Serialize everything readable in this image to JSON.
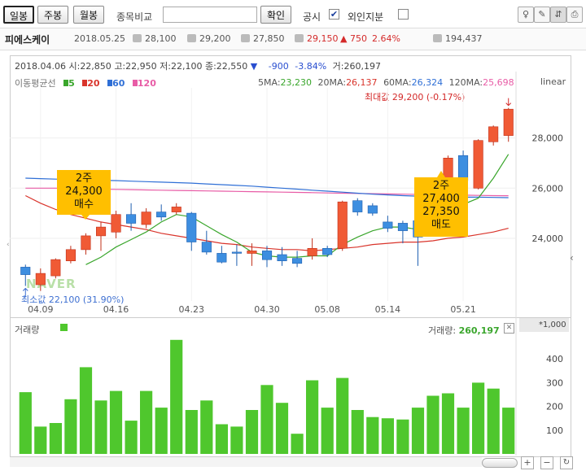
{
  "toolbar": {
    "period_tabs": [
      "일봉",
      "주봉",
      "월봉"
    ],
    "compare_label": "종목비교",
    "compare_placeholder": "",
    "confirm_label": "확인",
    "disclosure_label": "공시",
    "foreign_label": "외인지분"
  },
  "stock_info": {
    "name": "피에스케이",
    "date": "2018.05.25",
    "open": "28,100",
    "high": "29,200",
    "low": "27,850",
    "close": "29,150",
    "change": "▲ 750",
    "change_pct": "2.64%",
    "volume": "194,437"
  },
  "hover_info": {
    "date": "2018.04.06",
    "open_label": "시:",
    "open": "22,850",
    "high_label": "고:",
    "high": "22,950",
    "low_label": "저:",
    "low": "22,100",
    "close_label": "종:",
    "close": "22,550",
    "arrow": "▼",
    "change": "-900",
    "change_pct": "-3.84%",
    "volume_label": "거:",
    "volume": "260,197"
  },
  "legend": {
    "title": "이동평균선",
    "items": [
      {
        "label": "5",
        "color": "#3aa62c"
      },
      {
        "label": "20",
        "color": "#d9342b"
      },
      {
        "label": "60",
        "color": "#2f6fd6"
      },
      {
        "label": "120",
        "color": "#e85ca6"
      }
    ]
  },
  "ma_values": [
    {
      "label": "5MA:",
      "value": "23,230",
      "color": "#3aa62c"
    },
    {
      "label": "20MA:",
      "value": "26,137",
      "color": "#d9342b"
    },
    {
      "label": "60MA:",
      "value": "26,324",
      "color": "#2f6fd6"
    },
    {
      "label": "120MA:",
      "value": "25,698",
      "color": "#e85ca6"
    }
  ],
  "scale_label": "linear",
  "max_label": "최대값 29,200 (-0.17%)",
  "min_label": "최소값 22,100 (31.90%)",
  "watermark": "NAVER",
  "callouts": [
    {
      "lines": [
        "2주",
        "24,300",
        "매수"
      ]
    },
    {
      "lines": [
        "2주",
        "27,400",
        "27,350",
        "매도"
      ]
    }
  ],
  "volume_panel": {
    "title": "거래량",
    "value_label": "거래량:",
    "value": "260,197",
    "unit": "*1,000"
  },
  "colors": {
    "up": "#f05a35",
    "down": "#3d8ee0",
    "volume": "#4fc72d",
    "callout": "#ffbf00"
  },
  "chart_data": [
    {
      "type": "candlestick",
      "title": "",
      "x": [
        "04.06",
        "04.09",
        "04.10",
        "04.11",
        "04.12",
        "04.13",
        "04.16",
        "04.17",
        "04.18",
        "04.19",
        "04.20",
        "04.23",
        "04.24",
        "04.25",
        "04.26",
        "04.27",
        "04.30",
        "05.02",
        "05.03",
        "05.04",
        "05.08",
        "05.09",
        "05.10",
        "05.11",
        "05.14",
        "05.15",
        "05.16",
        "05.17",
        "05.18",
        "05.21",
        "05.23",
        "05.24",
        "05.25"
      ],
      "x_ticks": [
        "04.09",
        "04.16",
        "04.23",
        "04.30",
        "05.08",
        "05.14",
        "05.21"
      ],
      "y_ticks": [
        24000,
        26000,
        28000
      ],
      "ylim": [
        21500,
        30000
      ],
      "ohlc": [
        [
          22850,
          22950,
          22100,
          22550
        ],
        [
          22150,
          22800,
          21900,
          22600
        ],
        [
          22500,
          23200,
          22400,
          23150
        ],
        [
          23100,
          23700,
          23000,
          23550
        ],
        [
          23550,
          24200,
          23350,
          24100
        ],
        [
          24100,
          24650,
          23500,
          24450
        ],
        [
          24250,
          25100,
          24000,
          24950
        ],
        [
          24950,
          25400,
          24300,
          24600
        ],
        [
          24550,
          25200,
          24400,
          25050
        ],
        [
          25050,
          25350,
          24700,
          24850
        ],
        [
          25050,
          25400,
          24950,
          25250
        ],
        [
          25000,
          25050,
          23500,
          23850
        ],
        [
          23850,
          24300,
          23350,
          23450
        ],
        [
          23400,
          23700,
          23000,
          23050
        ],
        [
          23450,
          23750,
          22900,
          23400
        ],
        [
          23400,
          23800,
          22900,
          23500
        ],
        [
          23500,
          23700,
          22850,
          23150
        ],
        [
          23350,
          23650,
          22900,
          23100
        ],
        [
          23200,
          23500,
          22850,
          23000
        ],
        [
          23300,
          24000,
          23150,
          23600
        ],
        [
          23600,
          23700,
          23250,
          23350
        ],
        [
          23600,
          25500,
          23500,
          25450
        ],
        [
          25500,
          25600,
          24900,
          25050
        ],
        [
          25300,
          25400,
          24900,
          25000
        ],
        [
          24650,
          24900,
          24250,
          24400
        ],
        [
          24600,
          24700,
          23800,
          24300
        ],
        [
          24700,
          25000,
          22900,
          24050
        ],
        [
          25200,
          25600,
          24650,
          25300
        ],
        [
          25400,
          27300,
          25300,
          27200
        ],
        [
          27300,
          27500,
          26000,
          26300
        ],
        [
          26000,
          27950,
          25950,
          27900
        ],
        [
          27850,
          28500,
          27700,
          28450
        ],
        [
          28100,
          29200,
          27850,
          29150
        ]
      ],
      "ma5": [
        null,
        null,
        null,
        null,
        22950,
        23250,
        23650,
        23950,
        24250,
        24650,
        24950,
        24850,
        24500,
        24150,
        23850,
        23450,
        23300,
        23250,
        23250,
        23300,
        23300,
        23750,
        24050,
        24300,
        24450,
        24450,
        24350,
        24400,
        25050,
        25350,
        25600,
        26400,
        27350
      ],
      "ma20": [
        25700,
        25400,
        25150,
        24950,
        24800,
        24650,
        24550,
        24450,
        24350,
        24200,
        24100,
        24000,
        23900,
        23800,
        23750,
        23650,
        23600,
        23550,
        23550,
        23500,
        23550,
        23600,
        23650,
        23750,
        23800,
        23850,
        23850,
        23900,
        24000,
        24050,
        24150,
        24250,
        24400
      ],
      "ma60": [
        26400,
        26380,
        26360,
        26350,
        26330,
        26310,
        26300,
        26280,
        26260,
        26240,
        26220,
        26200,
        26170,
        26140,
        26110,
        26080,
        26040,
        26000,
        25960,
        25920,
        25880,
        25840,
        25800,
        25760,
        25730,
        25700,
        25680,
        25660,
        25650,
        25640,
        25640,
        25630,
        25620
      ],
      "ma120": [
        26000,
        26000,
        26000,
        25990,
        25980,
        25960,
        25950,
        25940,
        25930,
        25920,
        25910,
        25900,
        25890,
        25880,
        25870,
        25860,
        25850,
        25840,
        25830,
        25820,
        25810,
        25800,
        25790,
        25780,
        25770,
        25760,
        25750,
        25740,
        25730,
        25720,
        25710,
        25700,
        25698
      ]
    },
    {
      "type": "bar",
      "title": "거래량",
      "ylabel": "*1,000",
      "y_ticks": [
        100,
        200,
        300,
        400
      ],
      "ylim": [
        0,
        500
      ],
      "values": [
        260,
        115,
        130,
        230,
        365,
        225,
        265,
        140,
        265,
        195,
        480,
        185,
        225,
        125,
        115,
        185,
        290,
        215,
        85,
        310,
        195,
        320,
        185,
        155,
        150,
        145,
        195,
        245,
        255,
        195,
        300,
        275,
        195
      ]
    }
  ]
}
